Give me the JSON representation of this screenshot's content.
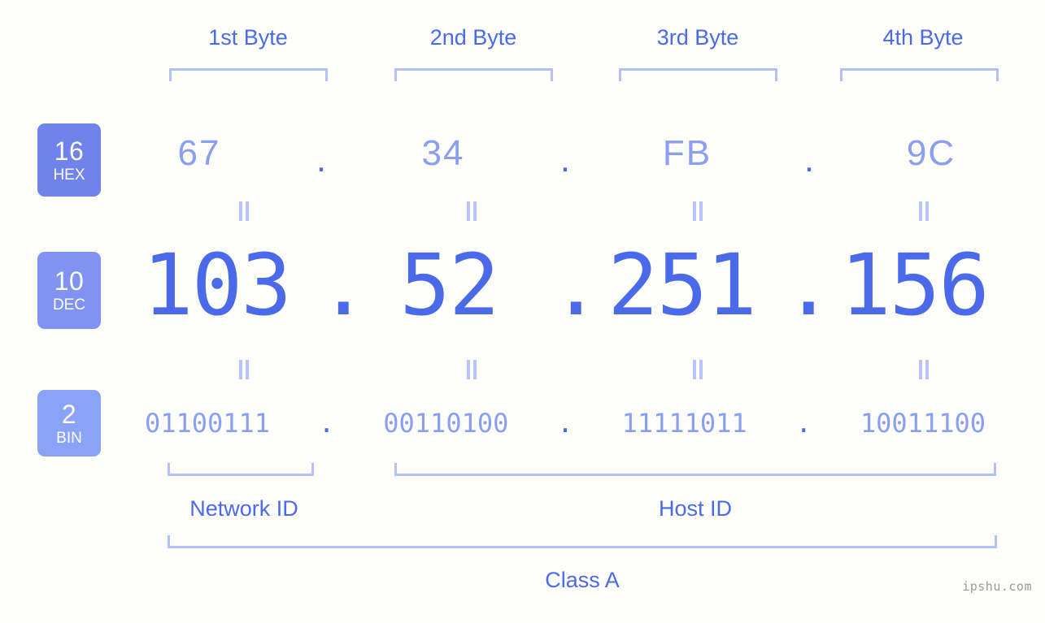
{
  "header": {
    "byte_labels": [
      "1st Byte",
      "2nd Byte",
      "3rd Byte",
      "4th Byte"
    ]
  },
  "bases": [
    {
      "number": "16",
      "name": "HEX",
      "color": "#7083ea"
    },
    {
      "number": "10",
      "name": "DEC",
      "color": "#8193f2"
    },
    {
      "number": "2",
      "name": "BIN",
      "color": "#8ba3f7"
    }
  ],
  "separator": ".",
  "rows": {
    "hex": {
      "values": [
        "67",
        "34",
        "FB",
        "9C"
      ]
    },
    "dec": {
      "values": [
        "103",
        "52",
        "251",
        "156"
      ]
    },
    "bin": {
      "values": [
        "01100111",
        "00110100",
        "11111011",
        "10011100"
      ]
    }
  },
  "equality_symbol": "=",
  "sections": {
    "network_id": "Network ID",
    "host_id": "Host ID",
    "class": "Class A"
  },
  "watermark": "ipshu.com",
  "colors": {
    "background": "#fdfdfa",
    "accent_strong": "#4a6aea",
    "accent_light": "#8b9ef0",
    "bracket": "#b3c0fa"
  }
}
